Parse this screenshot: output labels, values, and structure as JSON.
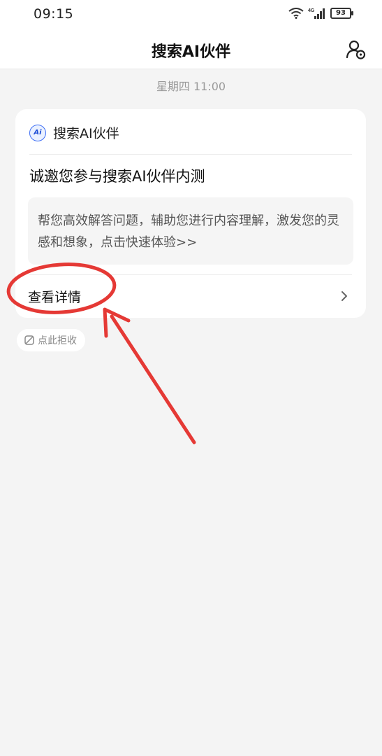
{
  "status_bar": {
    "time": "09:15",
    "battery_level": "93",
    "network": "4G"
  },
  "header": {
    "title": "搜索AI伙伴",
    "right_icon": "profile-settings-icon"
  },
  "message": {
    "timestamp": "星期四 11:00",
    "card": {
      "app_icon": "ai-logo-icon",
      "app_icon_text": "Ai",
      "app_name": "搜索AI伙伴",
      "title": "诚邀您参与搜索AI伙伴内测",
      "description": "帮您高效解答问题，辅助您进行内容理解，激发您的灵感和想象，点击快速体验>>",
      "action_label": "查看详情",
      "action_icon": "chevron-right-icon"
    },
    "reject": {
      "icon": "mute-icon",
      "label": "点此拒收"
    }
  },
  "colors": {
    "background": "#f4f4f4",
    "card": "#ffffff",
    "accent": "#3f6ff5",
    "annotation": "#e53935"
  }
}
